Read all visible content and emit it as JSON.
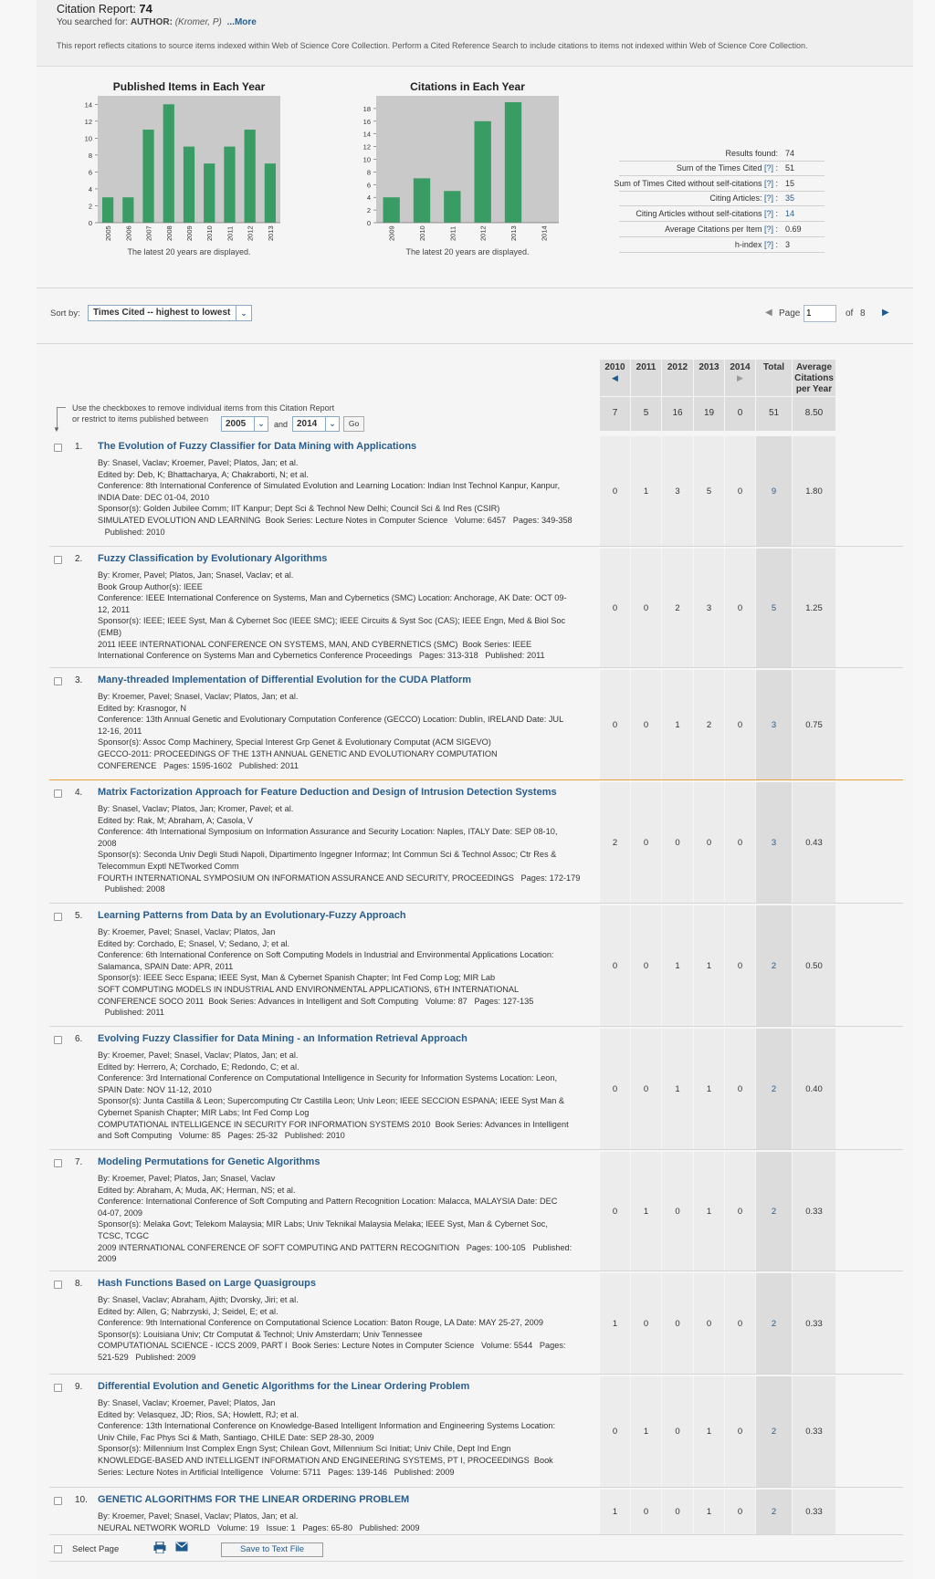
{
  "header": {
    "title_label": "Citation Report:",
    "title_count": "74",
    "searched_label": "You searched for:",
    "searched_query": "AUTHOR:",
    "searched_value": "(Kromer, P)",
    "more_link": "...More",
    "note": "This report reflects citations to source items indexed within Web of Science Core Collection. Perform a Cited Reference Search to include citations to items not indexed within Web of Science Core Collection."
  },
  "chart_data": [
    {
      "type": "bar",
      "title": "Published Items in Each Year",
      "categories": [
        "2005",
        "2006",
        "2007",
        "2008",
        "2009",
        "2010",
        "2011",
        "2012",
        "2013"
      ],
      "values": [
        3,
        3,
        11,
        14,
        9,
        7,
        9,
        11,
        7
      ],
      "ylim": [
        0,
        15
      ],
      "yticks": [
        0,
        2,
        4,
        6,
        8,
        10,
        12,
        14
      ],
      "color": "#3a9c65",
      "footnote": "The latest 20 years are displayed."
    },
    {
      "type": "bar",
      "title": "Citations in Each Year",
      "categories": [
        "2009",
        "2010",
        "2011",
        "2012",
        "2013",
        "2014"
      ],
      "values": [
        4,
        7,
        5,
        16,
        19,
        0
      ],
      "ylim": [
        0,
        20
      ],
      "yticks": [
        0,
        2,
        4,
        6,
        8,
        10,
        12,
        14,
        16,
        18
      ],
      "color": "#3a9c65",
      "footnote": "The latest 20 years are displayed."
    }
  ],
  "stats": [
    {
      "label": "Results found:",
      "help": "",
      "value": "74"
    },
    {
      "label": "Sum of the Times Cited",
      "help": "[?]",
      "value": "51"
    },
    {
      "label": "Sum of Times Cited without self-citations",
      "help": "[?]",
      "value": "15"
    },
    {
      "label": "Citing Articles:",
      "help": "[?]",
      "value": "35"
    },
    {
      "label": "Citing Articles without self-citations",
      "help": "[?]",
      "value": "14"
    },
    {
      "label": "Average Citations per Item",
      "help": "[?]",
      "value": "0.69"
    },
    {
      "label": "h-index",
      "help": "[?]",
      "value": "3"
    }
  ],
  "sort": {
    "label": "Sort by:",
    "value": "Times Cited -- highest to lowest"
  },
  "pager": {
    "page_label": "Page",
    "page_value": "1",
    "of_label": "of",
    "total_pages": "8"
  },
  "columns": {
    "years": [
      "2010",
      "2011",
      "2012",
      "2013",
      "2014"
    ],
    "total": "Total",
    "average": "Average Citations per Year",
    "totals": [
      "7",
      "5",
      "16",
      "19",
      "0"
    ],
    "total_sum": "51",
    "total_avg": "8.50"
  },
  "restrict": {
    "line1": "Use the checkboxes to remove individual items from this Citation Report",
    "line2": "or restrict to items published between",
    "from": "2005",
    "and": "and",
    "to": "2014",
    "go": "Go"
  },
  "records": [
    {
      "num": "1.",
      "title": "The Evolution of Fuzzy Classifier for Data Mining with Applications",
      "meta": [
        "By: Snasel, Vaclav; Kroemer, Pavel; Platos, Jan; et al.",
        "Edited by: Deb, K; Bhattacharya, A; Chakraborti, N; et al.",
        "Conference: 8th International Conference of Simulated Evolution and Learning Location: Indian Inst Technol Kanpur, Kanpur,",
        "INDIA Date: DEC 01-04, 2010",
        "Sponsor(s): Golden Jubilee Comm; IIT Kanpur; Dept Sci & Technol New Delhi; Council Sci & Ind Res (CSIR)",
        "SIMULATED EVOLUTION AND LEARNING  Book Series: Lecture Notes in Computer Science   Volume: 6457   Pages: 349-358",
        "   Published: 2010"
      ],
      "years": [
        "0",
        "1",
        "3",
        "5",
        "0"
      ],
      "total": "9",
      "avg": "1.80"
    },
    {
      "num": "2.",
      "title": "Fuzzy Classification by Evolutionary Algorithms",
      "meta": [
        "By: Kromer, Pavel; Platos, Jan; Snasel, Vaclav; et al.",
        "Book Group Author(s): IEEE",
        "Conference: IEEE International Conference on Systems, Man and Cybernetics (SMC) Location: Anchorage, AK Date: OCT 09-",
        "12, 2011",
        "Sponsor(s): IEEE; IEEE Syst, Man & Cybernet Soc (IEEE SMC); IEEE Circuits & Syst Soc (CAS); IEEE Engn, Med & Biol Soc",
        "(EMB)",
        "2011 IEEE INTERNATIONAL CONFERENCE ON SYSTEMS, MAN, AND CYBERNETICS (SMC)  Book Series: IEEE",
        "International Conference on Systems Man and Cybernetics Conference Proceedings   Pages: 313-318   Published: 2011"
      ],
      "years": [
        "0",
        "0",
        "2",
        "3",
        "0"
      ],
      "total": "5",
      "avg": "1.25"
    },
    {
      "num": "3.",
      "title": "Many-threaded Implementation of Differential Evolution for the CUDA Platform",
      "meta": [
        "By: Kroemer, Pavel; Snasel, Vaclav; Platos, Jan; et al.",
        "Edited by: Krasnogor, N",
        "Conference: 13th Annual Genetic and Evolutionary Computation Conference (GECCO) Location: Dublin, IRELAND Date: JUL",
        "12-16, 2011",
        "Sponsor(s): Assoc Comp Machinery, Special Interest Grp Genet & Evolutionary Computat (ACM SIGEVO)",
        "GECCO-2011: PROCEEDINGS OF THE 13TH ANNUAL GENETIC AND EVOLUTIONARY COMPUTATION",
        "CONFERENCE   Pages: 1595-1602   Published: 2011"
      ],
      "years": [
        "0",
        "0",
        "1",
        "2",
        "0"
      ],
      "total": "3",
      "avg": "0.75"
    },
    {
      "num": "4.",
      "title": "Matrix Factorization Approach for Feature Deduction and Design of Intrusion Detection Systems",
      "meta": [
        "By: Snasel, Vaclav; Platos, Jan; Kromer, Pavel; et al.",
        "Edited by: Rak, M; Abraham, A; Casola, V",
        "Conference: 4th International Symposium on Information Assurance and Security Location: Naples, ITALY Date: SEP 08-10,",
        "2008",
        "Sponsor(s): Seconda Univ Degli Studi Napoli, Dipartimento Ingegner Informaz; Int Commun Sci & Technol Assoc; Ctr Res &",
        "Telecommun Exptl NETworked Comm",
        "FOURTH INTERNATIONAL SYMPOSIUM ON INFORMATION ASSURANCE AND SECURITY, PROCEEDINGS   Pages: 172-179",
        "   Published: 2008"
      ],
      "years": [
        "2",
        "0",
        "0",
        "0",
        "0"
      ],
      "total": "3",
      "avg": "0.43"
    },
    {
      "num": "5.",
      "title": "Learning Patterns from Data by an Evolutionary-Fuzzy Approach",
      "meta": [
        "By: Kroemer, Pavel; Snasel, Vaclav; Platos, Jan",
        "Edited by: Corchado, E; Snasel, V; Sedano, J; et al.",
        "Conference: 6th International Conference on Soft Computing Models in Industrial and Environmental Applications Location:",
        "Salamanca, SPAIN Date: APR, 2011",
        "Sponsor(s): IEEE Secc Espana; IEEE Syst, Man & Cybernet Spanish Chapter; Int Fed Comp Log; MIR Lab",
        "SOFT COMPUTING MODELS IN INDUSTRIAL AND ENVIRONMENTAL APPLICATIONS, 6TH INTERNATIONAL",
        "CONFERENCE SOCO 2011  Book Series: Advances in Intelligent and Soft Computing   Volume: 87   Pages: 127-135",
        "   Published: 2011"
      ],
      "years": [
        "0",
        "0",
        "1",
        "1",
        "0"
      ],
      "total": "2",
      "avg": "0.50"
    },
    {
      "num": "6.",
      "title": "Evolving Fuzzy Classifier for Data Mining - an Information Retrieval Approach",
      "meta": [
        "By: Kroemer, Pavel; Snasel, Vaclav; Platos, Jan; et al.",
        "Edited by: Herrero, A; Corchado, E; Redondo, C; et al.",
        "Conference: 3rd International Conference on Computational Intelligence in Security for Information Systems Location: Leon,",
        "SPAIN Date: NOV 11-12, 2010",
        "Sponsor(s): Junta Castilla & Leon; Supercomputing Ctr Castilla Leon; Univ Leon; IEEE SECCION ESPANA; IEEE Syst Man &",
        "Cybernet Spanish Chapter; MIR Labs; Int Fed Comp Log",
        "COMPUTATIONAL INTELLIGENCE IN SECURITY FOR INFORMATION SYSTEMS 2010  Book Series: Advances in Intelligent",
        "and Soft Computing   Volume: 85   Pages: 25-32   Published: 2010"
      ],
      "years": [
        "0",
        "0",
        "1",
        "1",
        "0"
      ],
      "total": "2",
      "avg": "0.40"
    },
    {
      "num": "7.",
      "title": "Modeling Permutations for Genetic Algorithms",
      "meta": [
        "By: Kroemer, Pavel; Platos, Jan; Snasel, Vaclav",
        "Edited by: Abraham, A; Muda, AK; Herman, NS; et al.",
        "Conference: International Conference of Soft Computing and Pattern Recognition Location: Malacca, MALAYSIA Date: DEC",
        "04-07, 2009",
        "Sponsor(s): Melaka Govt; Telekom Malaysia; MIR Labs; Univ Teknikal Malaysia Melaka; IEEE Syst, Man & Cybernet Soc,",
        "TCSC, TCGC",
        "2009 INTERNATIONAL CONFERENCE OF SOFT COMPUTING AND PATTERN RECOGNITION   Pages: 100-105   Published:",
        "2009"
      ],
      "years": [
        "0",
        "1",
        "0",
        "1",
        "0"
      ],
      "total": "2",
      "avg": "0.33"
    },
    {
      "num": "8.",
      "title": "Hash Functions Based on Large Quasigroups",
      "meta": [
        "By: Snasel, Vaclav; Abraham, Ajith; Dvorsky, Jiri; et al.",
        "Edited by: Allen, G; Nabrzyski, J; Seidel, E; et al.",
        "Conference: 9th International Conference on Computational Science Location: Baton Rouge, LA Date: MAY 25-27, 2009",
        "Sponsor(s): Louisiana Univ; Ctr Computat & Technol; Univ Amsterdam; Univ Tennessee",
        "COMPUTATIONAL SCIENCE - ICCS 2009, PART I  Book Series: Lecture Notes in Computer Science   Volume: 5544   Pages:",
        "521-529   Published: 2009"
      ],
      "years": [
        "1",
        "0",
        "0",
        "0",
        "0"
      ],
      "total": "2",
      "avg": "0.33"
    },
    {
      "num": "9.",
      "title": "Differential Evolution and Genetic Algorithms for the Linear Ordering Problem",
      "meta": [
        "By: Snasel, Vaclav; Kroemer, Pavel; Platos, Jan",
        "Edited by: Velasquez, JD; Rios, SA; Howlett, RJ; et al.",
        "Conference: 13th International Conference on Knowledge-Based Intelligent Information and Engineering Systems Location:",
        "Univ Chile, Fac Phys Sci & Math, Santiago, CHILE Date: SEP 28-30, 2009",
        "Sponsor(s): Millennium Inst Complex Engn Syst; Chilean Govt, Millennium Sci Initiat; Univ Chile, Dept Ind Engn",
        "KNOWLEDGE-BASED AND INTELLIGENT INFORMATION AND ENGINEERING SYSTEMS, PT I, PROCEEDINGS  Book",
        "Series: Lecture Notes in Artificial Intelligence   Volume: 5711   Pages: 139-146   Published: 2009"
      ],
      "years": [
        "0",
        "1",
        "0",
        "1",
        "0"
      ],
      "total": "2",
      "avg": "0.33"
    },
    {
      "num": "10.",
      "title": "GENETIC ALGORITHMS FOR THE LINEAR ORDERING PROBLEM",
      "meta": [
        "By: Kroemer, Pavel; Snasel, Vaclav; Platos, Jan; et al.",
        "NEURAL NETWORK WORLD   Volume: 19   Issue: 1   Pages: 65-80   Published: 2009"
      ],
      "years": [
        "1",
        "0",
        "0",
        "1",
        "0"
      ],
      "total": "2",
      "avg": "0.33"
    }
  ],
  "footer": {
    "select_page": "Select Page",
    "save_button": "Save to Text File",
    "icons": [
      "print-icon",
      "email-icon"
    ]
  }
}
